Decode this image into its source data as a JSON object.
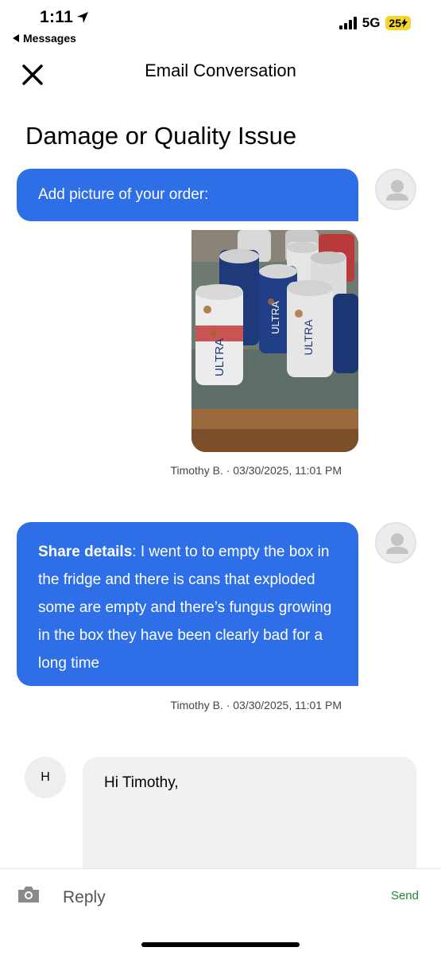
{
  "status_bar": {
    "time": "1:11",
    "back_app": "Messages",
    "network": "5G",
    "battery": "25"
  },
  "header": {
    "title": "Email Conversation",
    "close_icon": "close-icon"
  },
  "page_title": "Damage or Quality Issue",
  "messages": [
    {
      "text": "Add picture of your order:",
      "image": "photo of damaged Michelob Ultra cans",
      "meta": "Timothy B. · 03/30/2025, 11:01 PM"
    },
    {
      "label": "Share details",
      "text": ": I went to to empty the box in the fridge and there is cans that exploded some are empty and there’s fungus growing in the box they have been clearly bad for a long time",
      "meta": "Timothy B. · 03/30/2025, 11:01 PM"
    }
  ],
  "agent": {
    "initial": "H",
    "greeting": "Hi Timothy,"
  },
  "reply": {
    "placeholder": "Reply",
    "send_label": "Send"
  },
  "colors": {
    "bubble": "#2e6fe8",
    "send": "#1f8a3b",
    "battery": "#f5d52d"
  }
}
